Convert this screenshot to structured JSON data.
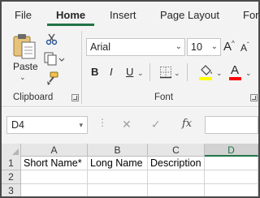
{
  "tabs": [
    "File",
    "Home",
    "Insert",
    "Page Layout",
    "Formulas"
  ],
  "active_tab": "Home",
  "clipboard": {
    "paste_label": "Paste",
    "group_label": "Clipboard"
  },
  "font": {
    "name": "Arial",
    "size": "10",
    "bold": "B",
    "italic": "I",
    "underline": "U",
    "group_label": "Font",
    "fill_color": "#ffff00",
    "font_color": "#ff0000"
  },
  "formula_bar": {
    "name_box": "D4",
    "fx": "fx",
    "cancel": "✕",
    "enter": "✓",
    "formula": ""
  },
  "grid": {
    "columns": [
      "A",
      "B",
      "C",
      "D"
    ],
    "selected_column": "D",
    "rows": [
      "1",
      "2",
      "3"
    ],
    "row1": [
      "Short Name*",
      "Long Name",
      "Description",
      ""
    ]
  },
  "colors": {
    "accent": "#217346",
    "ribbon_bg": "#f3f3f3"
  }
}
